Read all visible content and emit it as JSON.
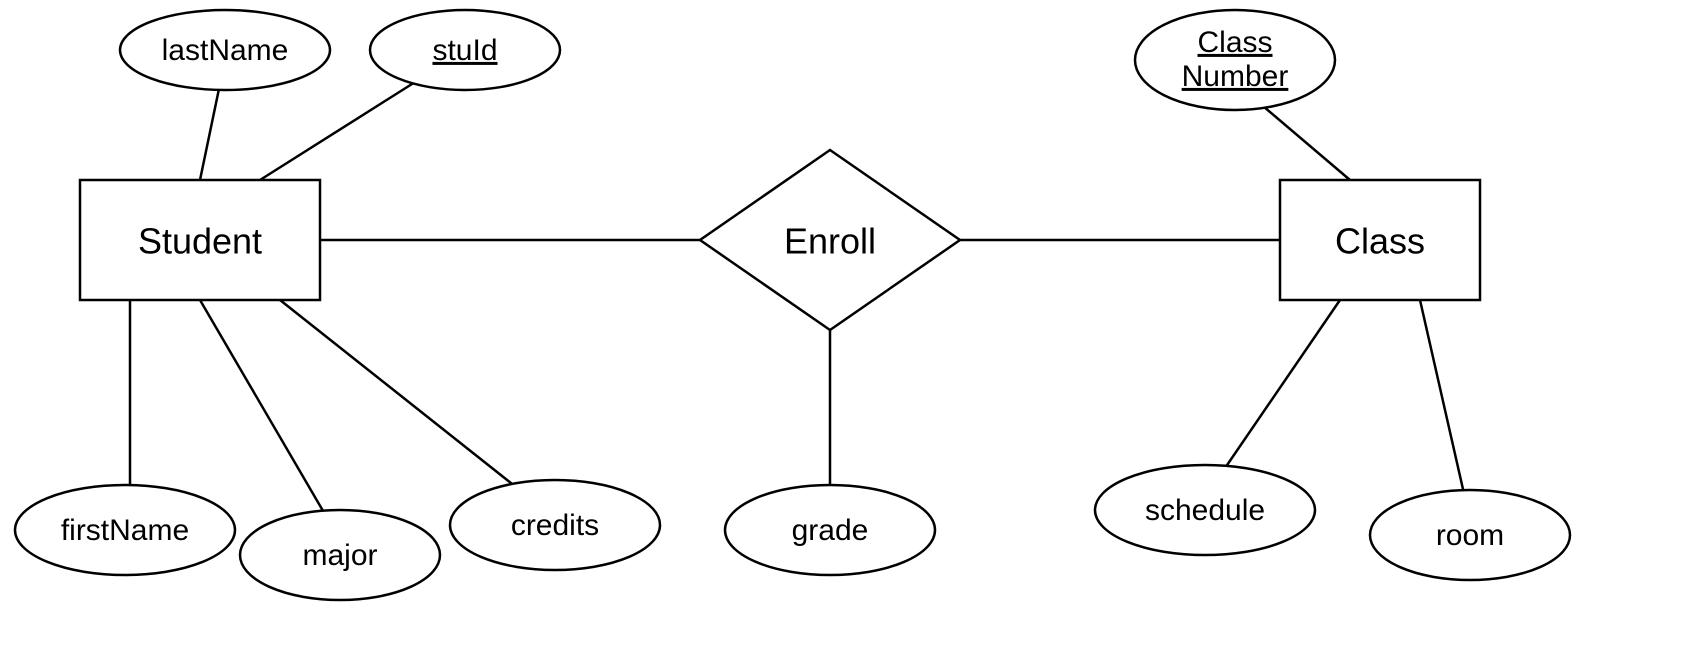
{
  "entities": {
    "student": {
      "label": "Student"
    },
    "class": {
      "label": "Class"
    }
  },
  "relationship": {
    "enroll": {
      "label": "Enroll"
    }
  },
  "attributes": {
    "lastName": {
      "label": "lastName",
      "key": false
    },
    "stuId": {
      "label": "stuId",
      "key": true
    },
    "firstName": {
      "label": "firstName",
      "key": false
    },
    "major": {
      "label": "major",
      "key": false
    },
    "credits": {
      "label": "credits",
      "key": false
    },
    "grade": {
      "label": "grade",
      "key": false
    },
    "classNumber": {
      "label_line1": "Class",
      "label_line2": "Number",
      "key": true
    },
    "schedule": {
      "label": "schedule",
      "key": false
    },
    "room": {
      "label": "room",
      "key": false
    }
  }
}
